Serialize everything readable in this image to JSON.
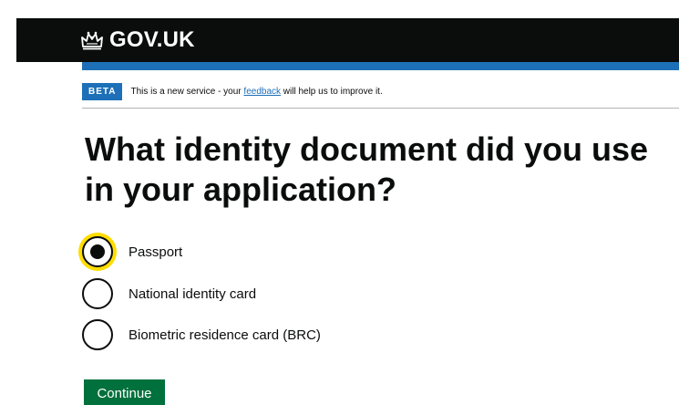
{
  "header": {
    "logo_text": "GOV.UK",
    "logo_icon": "crown-icon",
    "background": "#0b0c0c",
    "accent_bar": "#1d70b8"
  },
  "phase_banner": {
    "tag": "BETA",
    "text_before": "This is a new service - your ",
    "link_text": "feedback",
    "text_after": " will help us to improve it."
  },
  "question": {
    "title": "What identity document did you use in your application?"
  },
  "options": [
    {
      "label": "Passport",
      "selected": true
    },
    {
      "label": "National identity card",
      "selected": false
    },
    {
      "label": "Biometric residence card (BRC)",
      "selected": false
    }
  ],
  "actions": {
    "continue_label": "Continue",
    "button_color": "#00703c"
  },
  "colors": {
    "focus": "#ffdd00",
    "link": "#1d70b8"
  }
}
